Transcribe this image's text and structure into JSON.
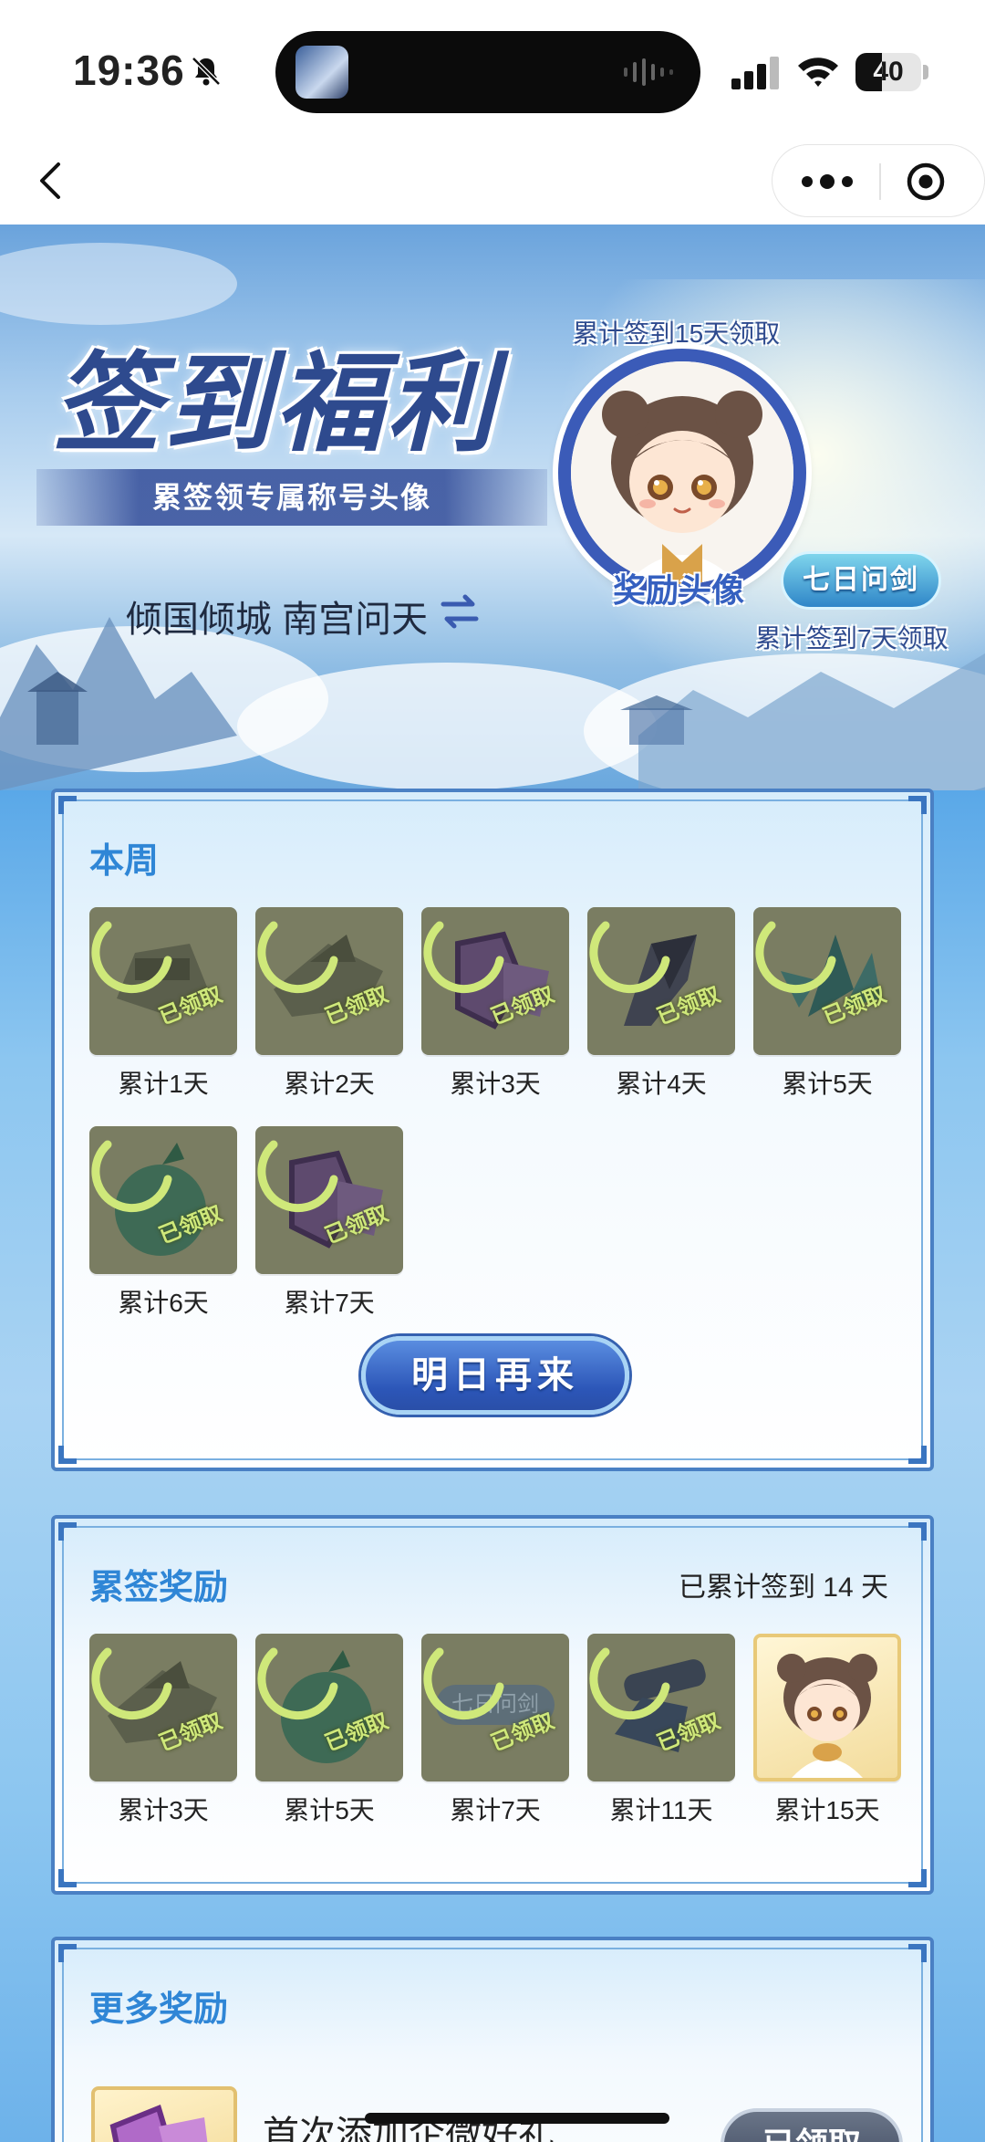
{
  "status_bar": {
    "time": "19:36",
    "battery_level": 40,
    "battery_label": "40",
    "icons": [
      "bell-muted-icon",
      "voice-wave-icon",
      "signal-icon",
      "wifi-icon",
      "battery-icon"
    ]
  },
  "navbar": {
    "icons": [
      "chevron-left-icon",
      "more-dots-icon",
      "target-close-icon"
    ]
  },
  "banner": {
    "title": "签到福利",
    "subtitle": "累签领专属称号头像",
    "player_name": "倾国倾城 南宫问天",
    "avatar_top_label": "累计签到15天领取",
    "avatar_label": "奖励头像",
    "title_badge": "七日问剑",
    "badge_bottom_label": "累计签到7天领取"
  },
  "weekly": {
    "title": "本周",
    "items": [
      {
        "label": "累计1天",
        "status": "已领取",
        "icon": "fort-item-icon"
      },
      {
        "label": "累计2天",
        "status": "已领取",
        "icon": "pavilion-item-icon"
      },
      {
        "label": "累计3天",
        "status": "已领取",
        "icon": "purple-frame-item-icon"
      },
      {
        "label": "累计4天",
        "status": "已领取",
        "icon": "dark-crystal-item-icon"
      },
      {
        "label": "累计5天",
        "status": "已领取",
        "icon": "green-crystal-item-icon"
      },
      {
        "label": "累计6天",
        "status": "已领取",
        "icon": "green-gourd-item-icon"
      },
      {
        "label": "累计7天",
        "status": "已领取",
        "icon": "purple-frame-item-icon"
      }
    ],
    "button": "明日再来"
  },
  "cumulative": {
    "title": "累签奖励",
    "summary": "已累计签到 14 天",
    "items": [
      {
        "label": "累计3天",
        "status": "已领取",
        "icon": "pavilion-item-icon"
      },
      {
        "label": "累计5天",
        "status": "已领取",
        "icon": "green-gourd-item-icon"
      },
      {
        "label": "累计7天",
        "status": "已领取",
        "icon": "title-badge-item-icon",
        "inner_text": "七日问剑"
      },
      {
        "label": "累计11天",
        "status": "已领取",
        "icon": "cannon-item-icon"
      },
      {
        "label": "累计15天",
        "status": "",
        "icon": "avatar-item-icon"
      }
    ]
  },
  "more": {
    "title": "更多奖励",
    "gift_title": "首次添加企微好礼",
    "gift_button": "已领取"
  },
  "colors": {
    "accent_blue": "#2f86d6",
    "panel_border": "#4a80c4",
    "claimed_tile": "#7a7d62",
    "claim_mark": "#cfe87a"
  }
}
